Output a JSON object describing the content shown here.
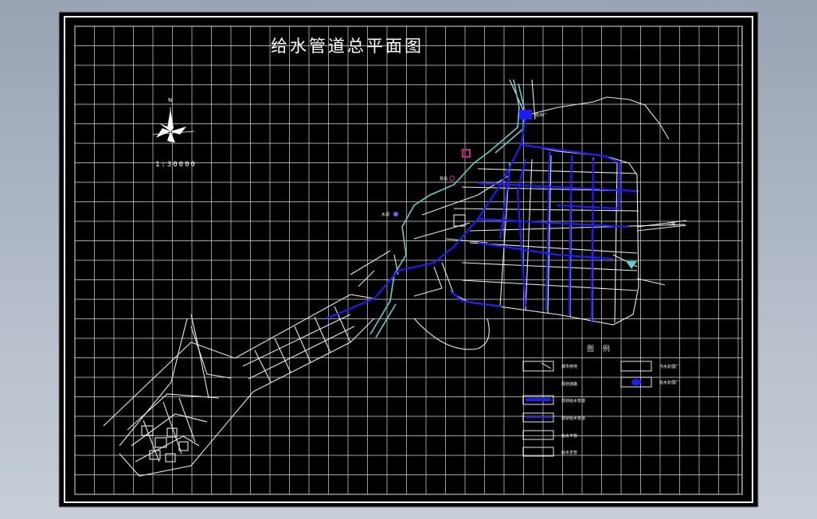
{
  "title": "给水管道总平面图",
  "scale": "1:30000",
  "north": "N",
  "places": {
    "water_plant": "给水厂",
    "pump_a": "泵站",
    "pump_b": "水源",
    "highway": "公路"
  },
  "legend": {
    "heading": "图 例",
    "items": [
      "城市用地",
      "规划给水管道",
      "现状给水管道",
      "给水干管",
      "给水支管",
      "规划道路"
    ],
    "right_items": [
      "污水处理厂",
      "给水处理厂"
    ]
  },
  "colors": {
    "background": "#000000",
    "grid": "#d8d8d8",
    "road": "#e8e8e8",
    "pipe": "#1c1cff",
    "river": "#5fd0d0",
    "marker": "#d02090"
  }
}
